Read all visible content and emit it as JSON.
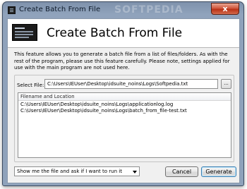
{
  "window": {
    "title": "Create Batch From File",
    "watermark": "SOFTPEDIA",
    "close_symbol": "x"
  },
  "header": {
    "title": "Create Batch From File"
  },
  "description": "This feature allows you to generate a batch file from a list of files/folders. As with the rest of the program, please use this feature carefully. Please note, settings applied for use with the main program are not used here.",
  "select_file": {
    "label": "Select File:",
    "value": "C:\\Users\\IEUser\\Desktop\\idsuite_noins\\Logs\\Softpedia.txt",
    "browse_label": "..."
  },
  "file_list": {
    "column_header": "Filename and Location",
    "rows": [
      "C:\\Users\\IEUser\\Desktop\\idsuite_noins\\Logs\\applicationlog.log",
      "C:\\Users\\IEUser\\Desktop\\idsuite_noins\\Logs\\batch_from_file-test.txt"
    ]
  },
  "footer": {
    "run_option": "Show me the file and ask if I want to run it",
    "cancel_label": "Cancel",
    "generate_label": "Generate"
  }
}
